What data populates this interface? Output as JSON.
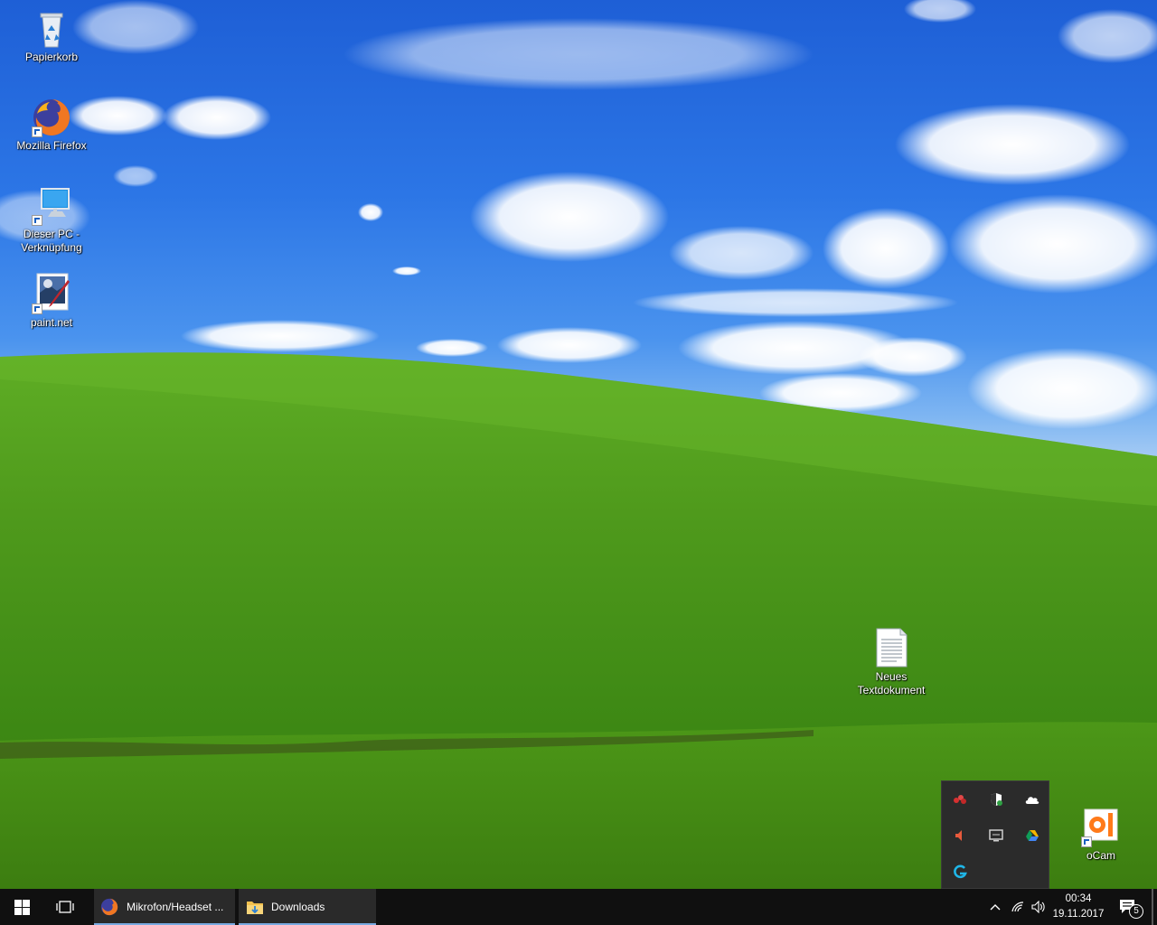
{
  "desktop": {
    "icons": [
      {
        "label": "Papierkorb"
      },
      {
        "label": "Mozilla Firefox"
      },
      {
        "label": "Dieser PC - Verknüpfung"
      },
      {
        "label": "paint.net"
      },
      {
        "label": "Neues Textdokument"
      },
      {
        "label": "oCam"
      }
    ]
  },
  "tray_popup": {
    "icons": [
      "network-status-icon",
      "security-shield-icon",
      "onedrive-cloud-icon",
      "volume-muted-icon",
      "monitor-app-icon",
      "google-drive-icon",
      "logitech-g-icon"
    ]
  },
  "taskbar": {
    "start_icon": "windows-start-icon",
    "task_view_icon": "task-view-icon",
    "items": [
      {
        "label": "Mikrofon/Headset ...",
        "icon": "firefox-icon"
      },
      {
        "label": "Downloads",
        "icon": "folder-icon"
      }
    ],
    "clock": {
      "time": "00:34",
      "date": "19.11.2017"
    },
    "notification_count": "5"
  },
  "colors": {
    "taskbar": "#101010",
    "accent": "#77a9e0",
    "sky": "#2c76e6",
    "grass": "#4f9a1c"
  }
}
